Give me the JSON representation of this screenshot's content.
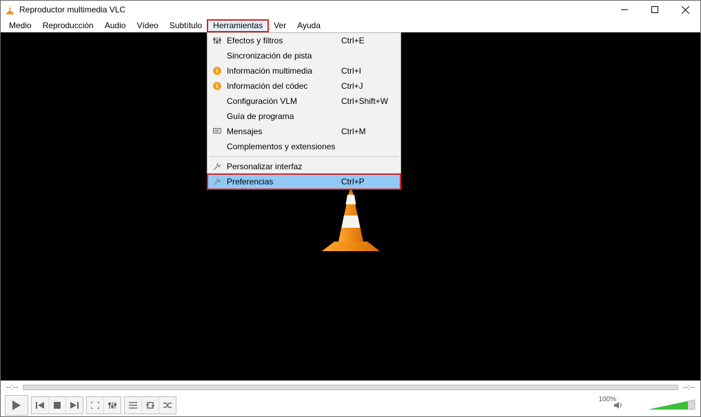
{
  "titlebar": {
    "title": "Reproductor multimedia VLC"
  },
  "menubar": {
    "items": [
      "Medio",
      "Reproducción",
      "Audio",
      "Vídeo",
      "Subtítulo",
      "Herramientas",
      "Ver",
      "Ayuda"
    ],
    "highlighted_index": 5
  },
  "dropdown": {
    "items": [
      {
        "icon": "equalizer",
        "label": "Efectos y filtros",
        "shortcut": "Ctrl+E"
      },
      {
        "icon": "",
        "label": "Sincronización de pista",
        "shortcut": ""
      },
      {
        "icon": "info",
        "label": "Información multimedia",
        "shortcut": "Ctrl+I"
      },
      {
        "icon": "info",
        "label": "Información del códec",
        "shortcut": "Ctrl+J"
      },
      {
        "icon": "",
        "label": "Configuración VLM",
        "shortcut": "Ctrl+Shift+W"
      },
      {
        "icon": "",
        "label": "Guía de programa",
        "shortcut": ""
      },
      {
        "icon": "messages",
        "label": "Mensajes",
        "shortcut": "Ctrl+M"
      },
      {
        "icon": "",
        "label": "Complementos y extensiones",
        "shortcut": ""
      },
      {
        "separator": true
      },
      {
        "icon": "wrench",
        "label": "Personalizar interfaz",
        "shortcut": ""
      },
      {
        "icon": "wrench",
        "label": "Preferencias",
        "shortcut": "Ctrl+P",
        "highlighted": true
      }
    ]
  },
  "seek": {
    "start": "--:--",
    "end": "--:--"
  },
  "volume": {
    "percent": "100%"
  }
}
